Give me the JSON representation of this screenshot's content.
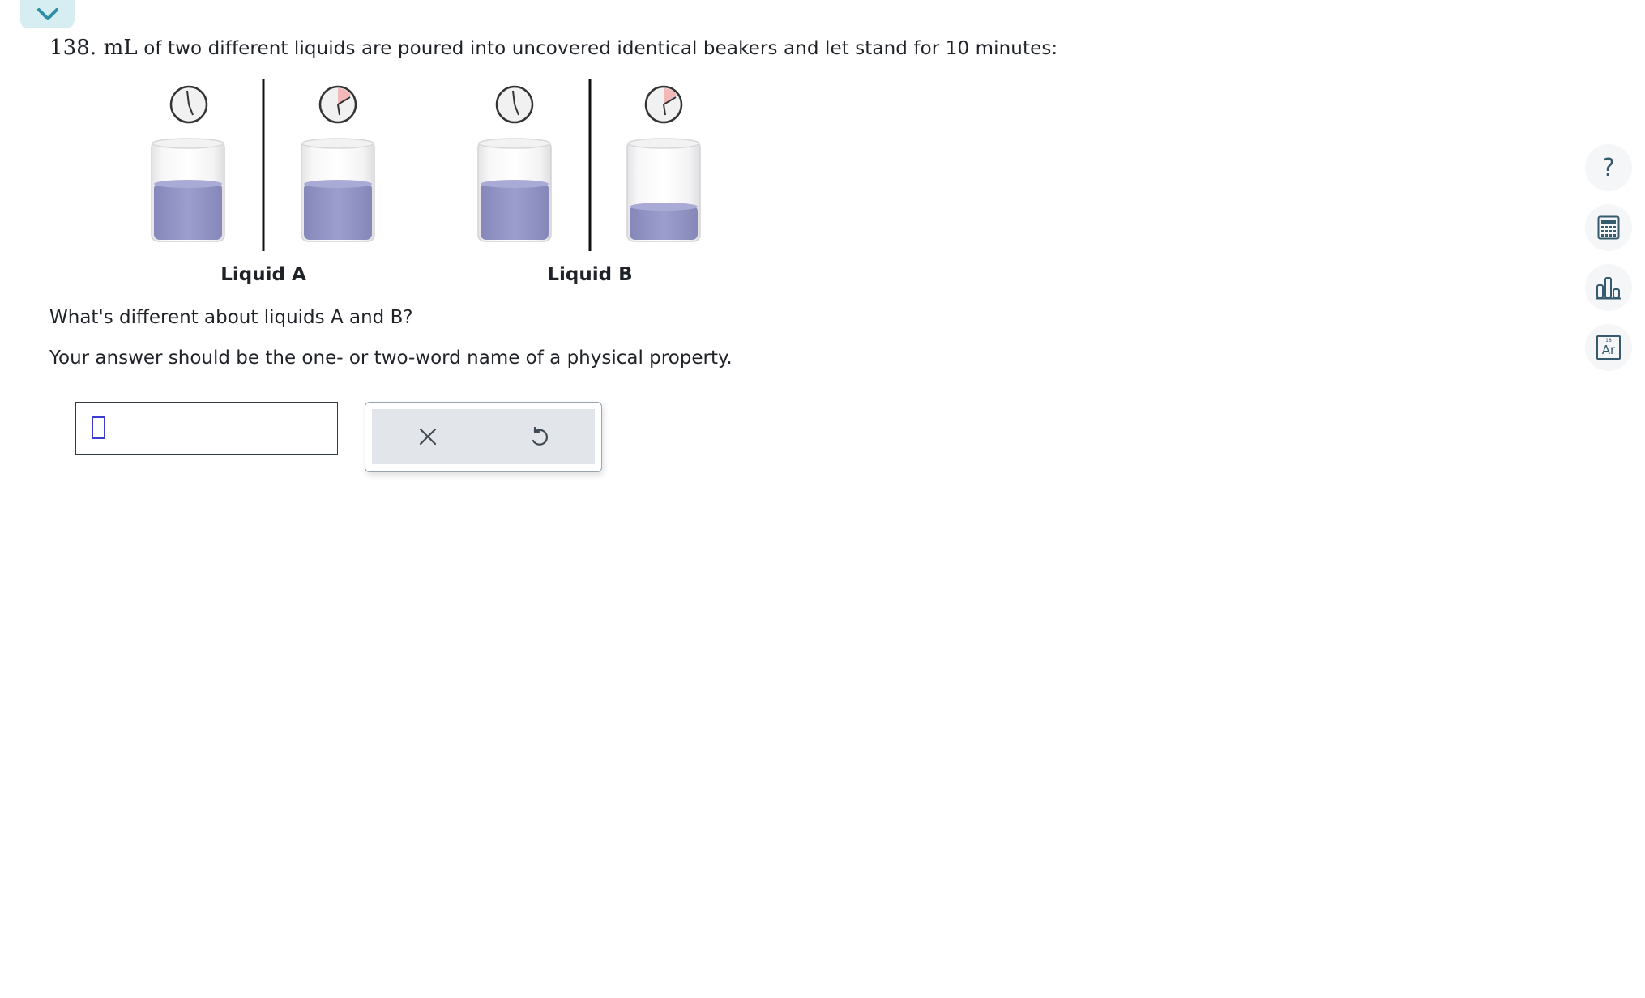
{
  "header": {
    "collapse_icon": "chevron-down-icon"
  },
  "problem": {
    "quantity": "138. mL",
    "statement": "of two different liquids are poured into uncovered identical beakers and let stand for 10 minutes:",
    "liquid_a_label": "Liquid A",
    "liquid_b_label": "Liquid B",
    "question": "What's different about liquids A and B?",
    "instruction": "Your answer should be the one- or two-word name of a physical property."
  },
  "answer": {
    "value": ""
  },
  "actions": {
    "clear_icon": "close-icon",
    "undo_icon": "undo-icon"
  },
  "toolbar": {
    "help_label": "?",
    "help_icon": "question-icon",
    "calculator_icon": "calculator-icon",
    "data_icon": "bar-chart-icon",
    "periodic_table_icon": "periodic-table-icon",
    "periodic_element": "Ar",
    "periodic_number": "18"
  },
  "colors": {
    "liquid": "#8f92c4",
    "accent": "#3b3bd6",
    "tool_icon": "#355a6e",
    "tab": "#d6eef2"
  }
}
